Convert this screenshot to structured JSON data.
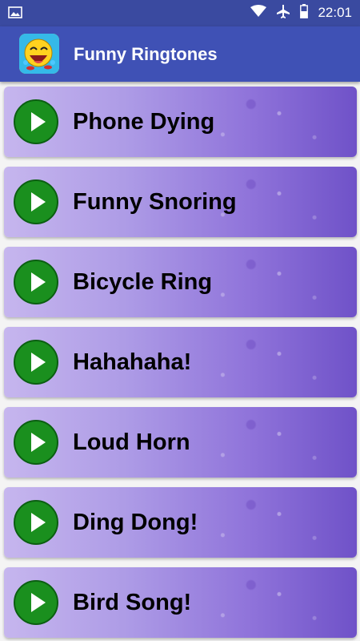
{
  "status_bar": {
    "time": "22:01",
    "icons": [
      "image-icon",
      "wifi-icon",
      "airplane-icon",
      "battery-icon"
    ]
  },
  "app_bar": {
    "title": "Funny Ringtones",
    "icon": "laughing-face-icon"
  },
  "ringtones": [
    {
      "label": "Phone Dying"
    },
    {
      "label": "Funny Snoring"
    },
    {
      "label": "Bicycle Ring"
    },
    {
      "label": "Hahahaha!"
    },
    {
      "label": "Loud Horn"
    },
    {
      "label": "Ding Dong!"
    },
    {
      "label": "Bird Song!"
    }
  ],
  "colors": {
    "status_bar": "#3a4aa0",
    "app_bar": "#3f51b5",
    "play_button": "#1a8f1e",
    "item_background": "#ad9be6"
  }
}
